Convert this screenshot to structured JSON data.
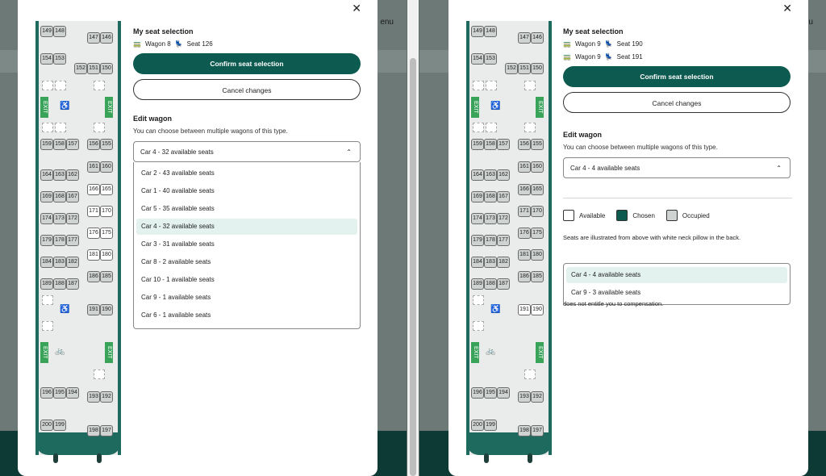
{
  "background": {
    "menu_label": "enu"
  },
  "left": {
    "close_icon": "close-icon",
    "selection": {
      "heading": "My seat selection",
      "rows": [
        {
          "wagon": "Wagon 8",
          "seat": "Seat 126"
        }
      ]
    },
    "confirm_label": "Confirm seat selection",
    "cancel_label": "Cancel changes",
    "edit_heading": "Edit wagon",
    "edit_sub": "You can choose between multiple wagons of this type.",
    "select_value": "Car 4 - 32 available seats",
    "options": [
      "Car 2 - 43 available seats",
      "Car 1 - 40 available seats",
      "Car 5 - 35 available seats",
      "Car 4 - 32 available seats",
      "Car 3 - 31 available seats",
      "Car 8 - 2 available seats",
      "Car 10 - 1 available seats",
      "Car 9 - 1 available seats",
      "Car 6 - 1 available seats"
    ],
    "active_option_index": 3
  },
  "right": {
    "selection": {
      "heading": "My seat selection",
      "rows": [
        {
          "wagon": "Wagon 9",
          "seat": "Seat 190"
        },
        {
          "wagon": "Wagon 9",
          "seat": "Seat 191"
        }
      ]
    },
    "confirm_label": "Confirm seat selection",
    "cancel_label": "Cancel changes",
    "edit_heading": "Edit wagon",
    "edit_sub": "You can choose between multiple wagons of this type.",
    "select_value": "Car 4 - 4 available seats",
    "legend": {
      "available": "Available",
      "chosen": "Chosen",
      "occupied": "Occupied"
    },
    "note": "Seats are illustrated from above with white neck pillow in the back.",
    "note_tail": "does not entitle you to compensation.",
    "options": [
      "Car 4 - 4 available seats",
      "Car 9 - 3 available seats"
    ],
    "active_option_index": 0
  },
  "train": {
    "exit_label": "EXIT",
    "rows_left": [
      [
        "149",
        "148"
      ],
      [
        "154",
        "153"
      ],
      [
        "159",
        "158",
        "157"
      ],
      [
        "164",
        "163",
        "162"
      ],
      [
        "169",
        "168",
        "167"
      ],
      [
        "174",
        "173",
        "172"
      ],
      [
        "179",
        "178",
        "177"
      ],
      [
        "184",
        "183",
        "182"
      ],
      [
        "189",
        "188",
        "187"
      ],
      [
        "196",
        "195",
        "194"
      ],
      [
        "200",
        "199"
      ]
    ],
    "rows_right": [
      [
        "147",
        "146"
      ],
      [
        "152",
        "151",
        "150"
      ],
      [
        "156",
        "155"
      ],
      [
        "161",
        "160"
      ],
      [
        "166",
        "165"
      ],
      [
        "171",
        "170"
      ],
      [
        "176",
        "175"
      ],
      [
        "181",
        "180"
      ],
      [
        "186",
        "185"
      ],
      [
        "191",
        "190"
      ],
      [
        "193",
        "192"
      ],
      [
        "198",
        "197"
      ]
    ]
  },
  "colors": {
    "primary": "#0d5a50",
    "exit": "#3aa35a",
    "wagon_frame": "#1e6a5e",
    "active_option": "#e3f2ef"
  }
}
